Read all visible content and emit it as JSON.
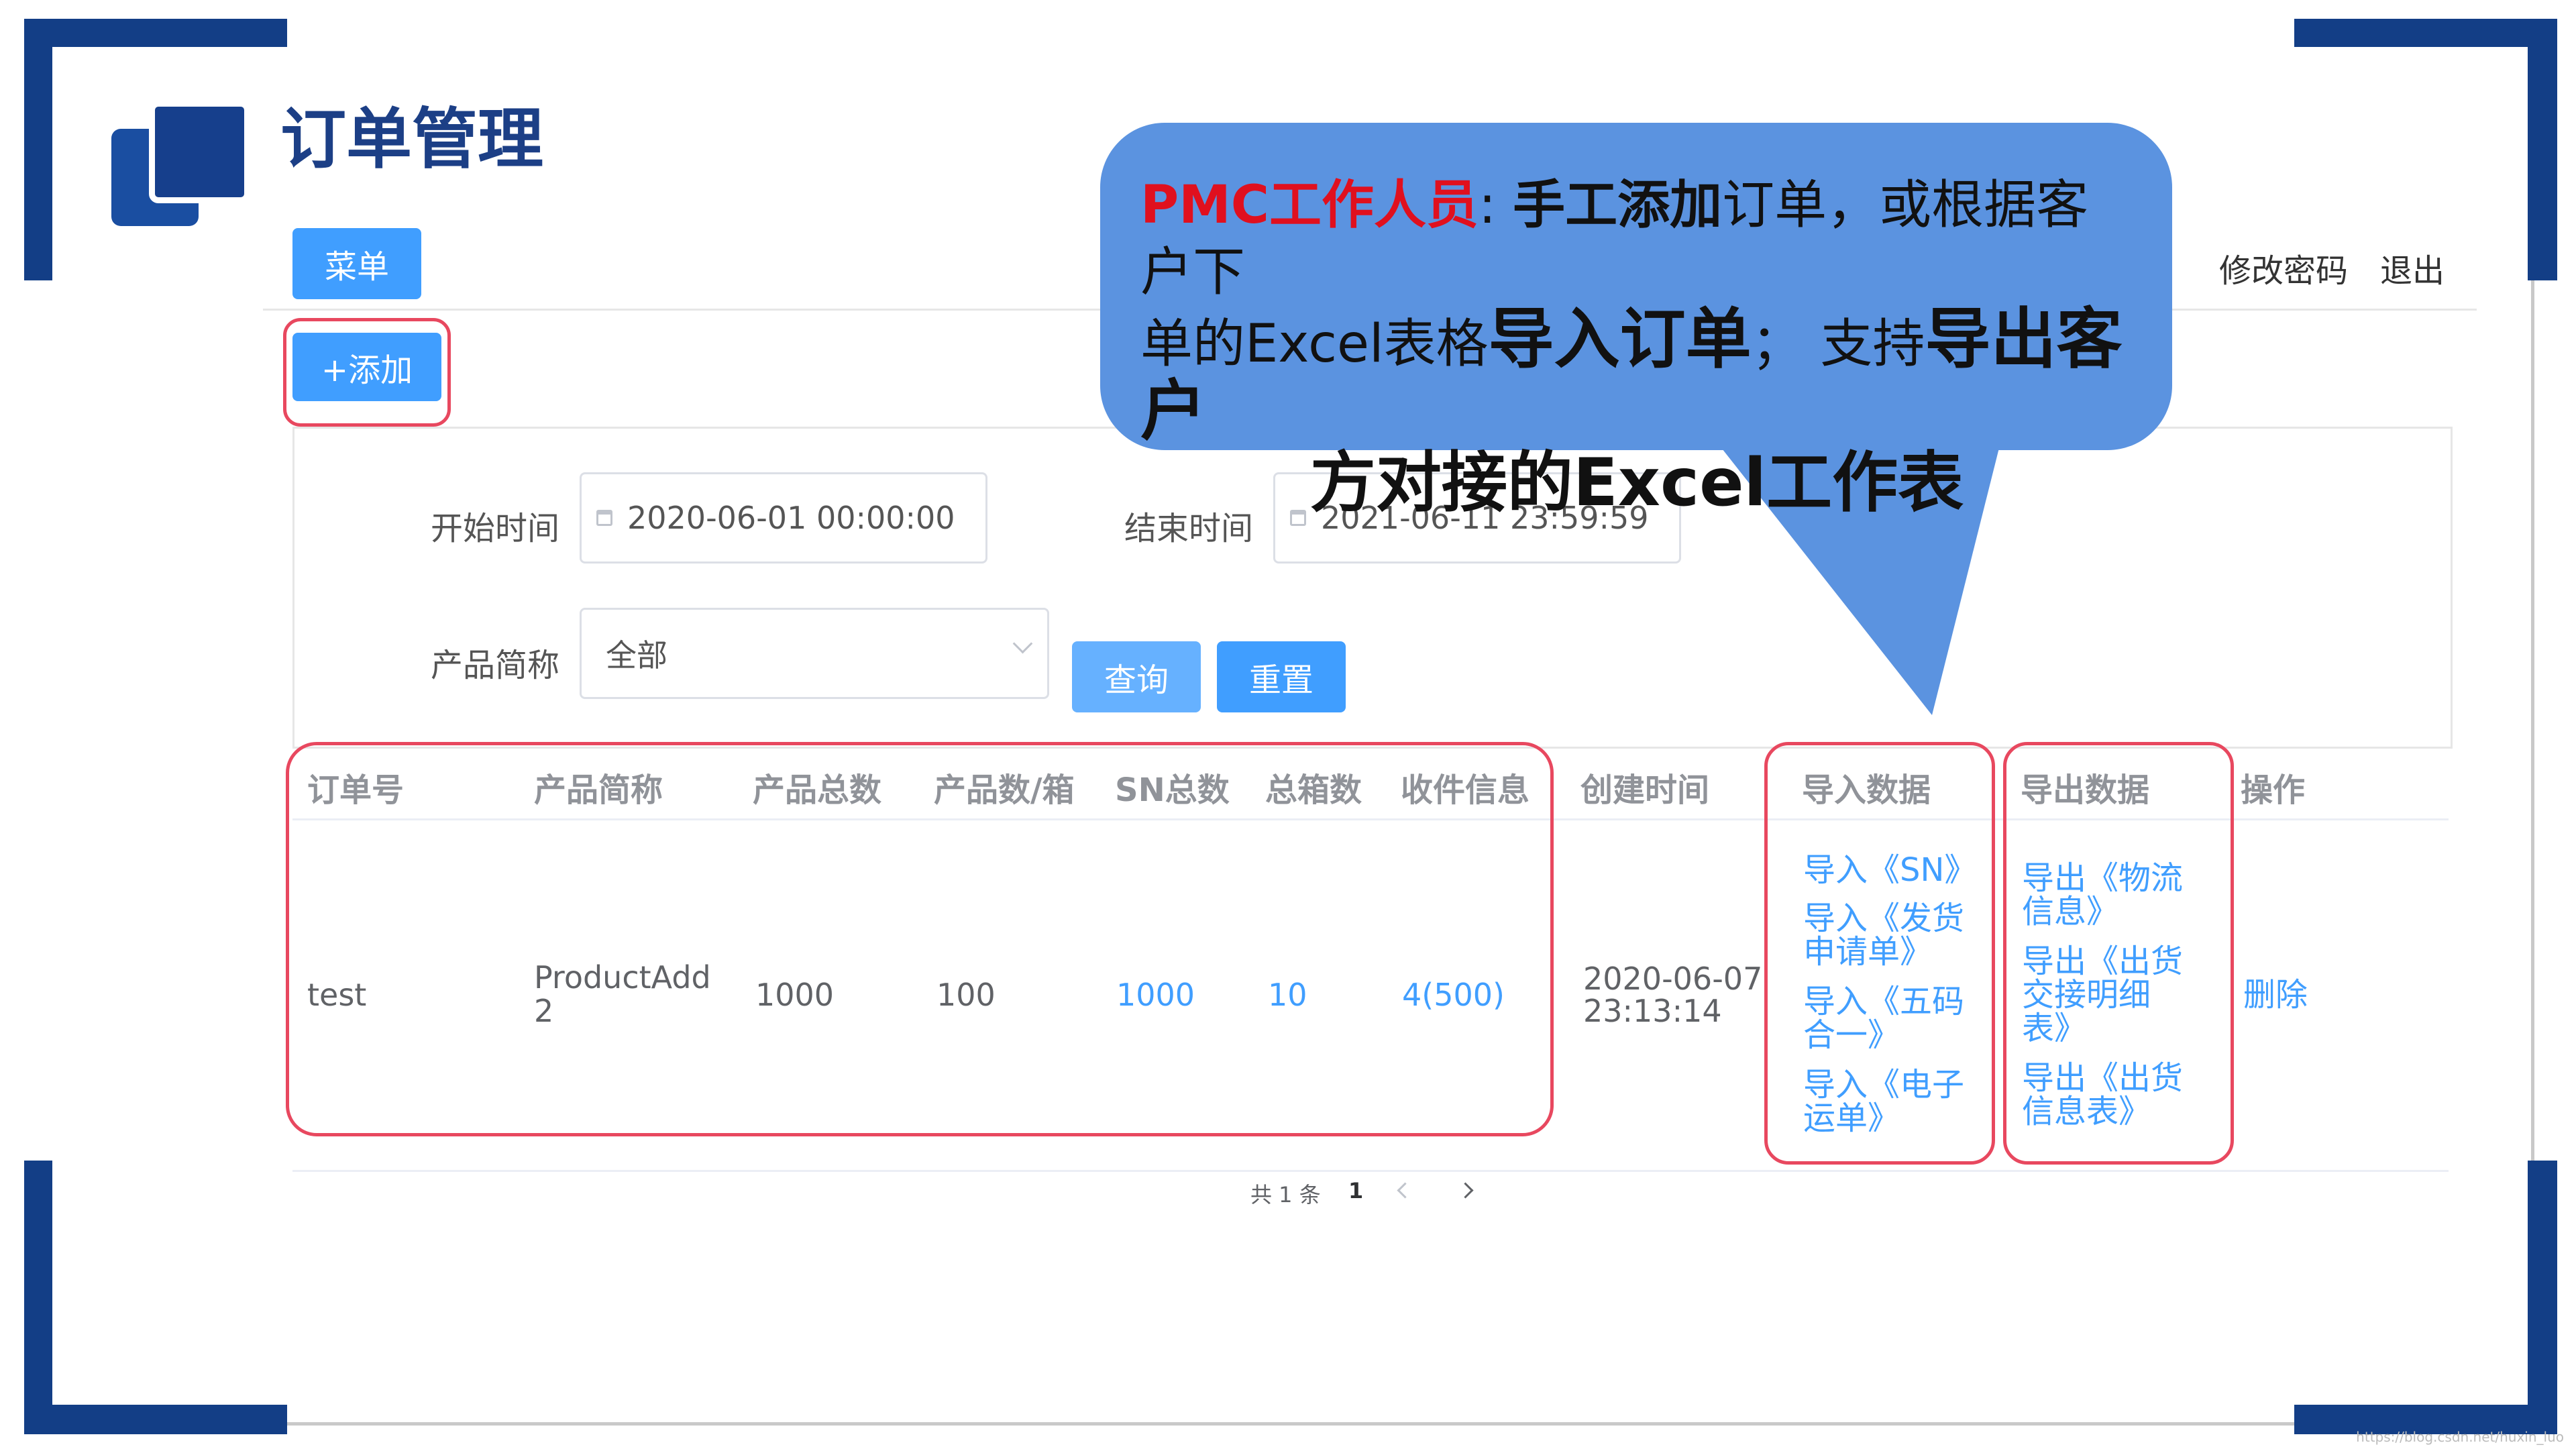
{
  "colors": {
    "brand_navy": "#133e86",
    "primary": "#409eff",
    "primary_light": "#66b1ff",
    "highlight_red": "#e8485f",
    "callout_blue": "#5b93e0",
    "callout_red_text": "#e0101e"
  },
  "page": {
    "title": "订单管理"
  },
  "header": {
    "menu_label": "菜单",
    "change_password": "修改密码",
    "logout": "退出"
  },
  "toolbar": {
    "add_label": "+添加"
  },
  "filters": {
    "start_label": "开始时间",
    "start_value": "2020-06-01 00:00:00",
    "end_label": "结束时间",
    "end_value": "2021-06-11 23:59:59",
    "product_label": "产品简称",
    "product_value": "全部",
    "query_label": "查询",
    "reset_label": "重置"
  },
  "table": {
    "columns": [
      "订单号",
      "产品简称",
      "产品总数",
      "产品数/箱",
      "SN总数",
      "总箱数",
      "收件信息",
      "创建时间",
      "导入数据",
      "导出数据",
      "操作"
    ],
    "rows": [
      {
        "order_no": "test",
        "product_line1": "ProductAdd",
        "product_line2": "2",
        "product_total": "1000",
        "per_box": "100",
        "sn_total": "1000",
        "box_total": "10",
        "receiver": "4(500)",
        "created_line1": "2020-06-07",
        "created_line2": "23:13:14",
        "import_links": [
          [
            "导入《SN》"
          ],
          [
            "导入《发货",
            "申请单》"
          ],
          [
            "导入《五码",
            "合一》"
          ],
          [
            "导入《电子",
            "运单》"
          ]
        ],
        "export_links": [
          [
            "导出《物流",
            "信息》"
          ],
          [
            "导出《出货",
            "交接明细",
            "表》"
          ],
          [
            "导出《出货",
            "信息表》"
          ]
        ],
        "action": "删除"
      }
    ]
  },
  "pagination": {
    "total_text": "共 1 条",
    "current_page": "1",
    "prev_icon": "chevron-left-icon",
    "next_icon": "chevron-right-icon"
  },
  "callout": {
    "role": "PMC工作人员",
    "sep": ": ",
    "bold1": "手工添加",
    "t1": "订单，或根据客户下",
    "t2": "单的Excel表格",
    "big1": "导入订单",
    "t3": "； 支持",
    "big2": "导出客户",
    "big3": "方对接的Excel工作表"
  },
  "watermark": "https://blog.csdn.net/huxin_luo"
}
